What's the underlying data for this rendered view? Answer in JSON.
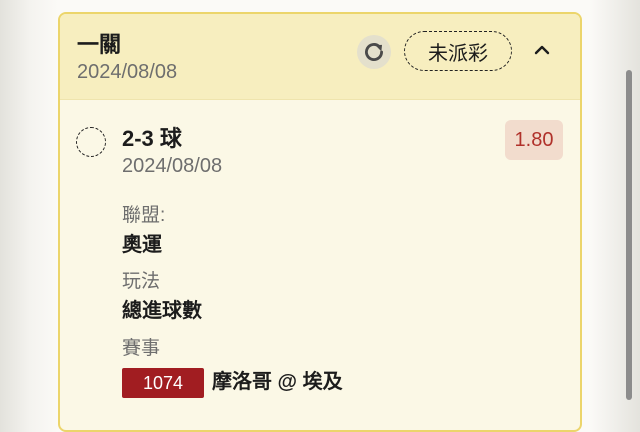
{
  "bet": {
    "title": "一關",
    "date": "2024/08/08",
    "status": "未派彩",
    "icons": {
      "refresh": "refresh-icon",
      "collapse": "chevron-up-icon",
      "selection": "selection-circle-icon"
    }
  },
  "selection": {
    "name": "2-3 球",
    "date": "2024/08/08",
    "odds": "1.80"
  },
  "details": {
    "league_label": "聯盟:",
    "league_value": "奧運",
    "play_label": "玩法",
    "play_value": "總進球數",
    "match_label": "賽事",
    "match_number": "1074",
    "match_name": "摩洛哥 @ 埃及"
  },
  "colors": {
    "header_bg": "#f7eebf",
    "card_bg": "#fbf8e6",
    "card_border": "#ecd56b",
    "odds_text": "#b0312a",
    "odds_bg": "#f2dccd",
    "match_number_bg": "#a11d21"
  }
}
